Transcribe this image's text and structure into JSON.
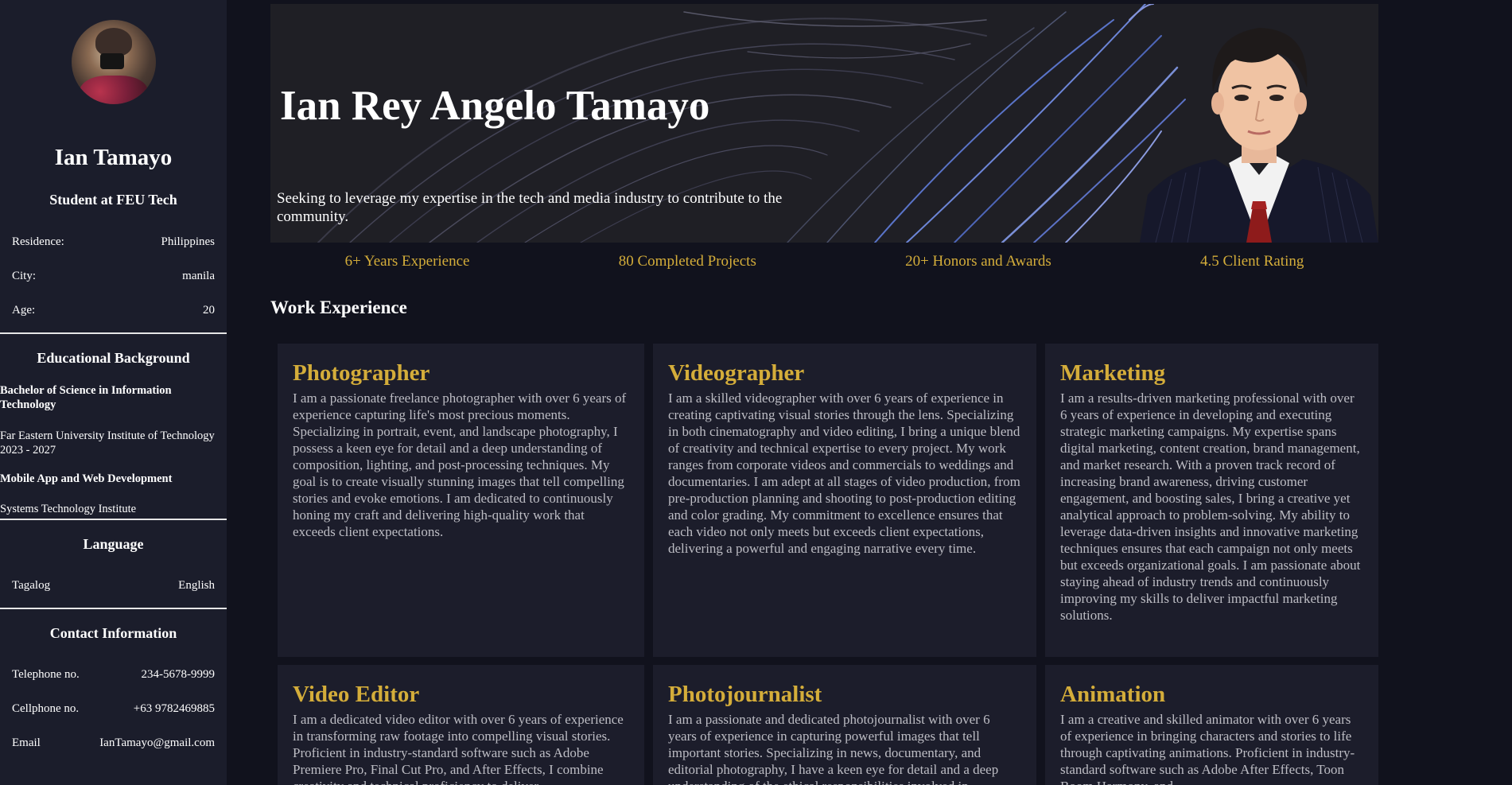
{
  "sidebar": {
    "name": "Ian Tamayo",
    "role": "Student at FEU Tech",
    "personal": [
      {
        "label": "Residence:",
        "value": "Philippines"
      },
      {
        "label": "City:",
        "value": "manila"
      },
      {
        "label": "Age:",
        "value": "20"
      }
    ],
    "education": {
      "title": "Educational Background",
      "lines": [
        "Bachelor of Science in Information Technology",
        "Far Eastern University Institute of Technology 2023 - 2027",
        "Mobile App and Web Development",
        "Systems Technology Institute"
      ]
    },
    "language": {
      "title": "Language",
      "items": [
        "Tagalog",
        "English"
      ]
    },
    "contact": {
      "title": "Contact Information",
      "items": [
        {
          "label": "Telephone no.",
          "value": "234-5678-9999"
        },
        {
          "label": "Cellphone no.",
          "value": "+63 9782469885"
        },
        {
          "label": "Email",
          "value": "IanTamayo@gmail.com"
        }
      ]
    }
  },
  "hero": {
    "title": "Ian Rey Angelo Tamayo",
    "subtitle": "Seeking to leverage my expertise in the tech and media industry to contribute to the community."
  },
  "stats": [
    "6+ Years Experience",
    "80 Completed Projects",
    "20+ Honors and Awards",
    "4.5 Client Rating"
  ],
  "work": {
    "title": "Work Experience",
    "cards": [
      {
        "title": "Photographer",
        "text": "I am a passionate freelance photographer with over 6 years of experience capturing life's most precious moments. Specializing in portrait, event, and landscape photography, I possess a keen eye for detail and a deep understanding of composition, lighting, and post-processing techniques. My goal is to create visually stunning images that tell compelling stories and evoke emotions. I am dedicated to continuously honing my craft and delivering high-quality work that exceeds client expectations."
      },
      {
        "title": "Videographer",
        "text": "I am a skilled videographer with over 6 years of experience in creating captivating visual stories through the lens. Specializing in both cinematography and video editing, I bring a unique blend of creativity and technical expertise to every project. My work ranges from corporate videos and commercials to weddings and documentaries. I am adept at all stages of video production, from pre-production planning and shooting to post-production editing and color grading. My commitment to excellence ensures that each video not only meets but exceeds client expectations, delivering a powerful and engaging narrative every time."
      },
      {
        "title": "Marketing",
        "text": "I am a results-driven marketing professional with over 6 years of experience in developing and executing strategic marketing campaigns. My expertise spans digital marketing, content creation, brand management, and market research. With a proven track record of increasing brand awareness, driving customer engagement, and boosting sales, I bring a creative yet analytical approach to problem-solving. My ability to leverage data-driven insights and innovative marketing techniques ensures that each campaign not only meets but exceeds organizational goals. I am passionate about staying ahead of industry trends and continuously improving my skills to deliver impactful marketing solutions."
      },
      {
        "title": "Video Editor",
        "text": "I am a dedicated video editor with over 6 years of experience in transforming raw footage into compelling visual stories. Proficient in industry-standard software such as Adobe Premiere Pro, Final Cut Pro, and After Effects, I combine creativity and technical proficiency to deliver"
      },
      {
        "title": "Photojournalist",
        "text": "I am a passionate and dedicated photojournalist with over 6 years of experience in capturing powerful images that tell important stories. Specializing in news, documentary, and editorial photography, I have a keen eye for detail and a deep understanding of the ethical responsibilities involved in"
      },
      {
        "title": "Animation",
        "text": "I am a creative and skilled animator with over 6 years of experience in bringing characters and stories to life through captivating animations. Proficient in industry-standard software such as Adobe After Effects, Toon Boom Harmony, and"
      }
    ]
  }
}
